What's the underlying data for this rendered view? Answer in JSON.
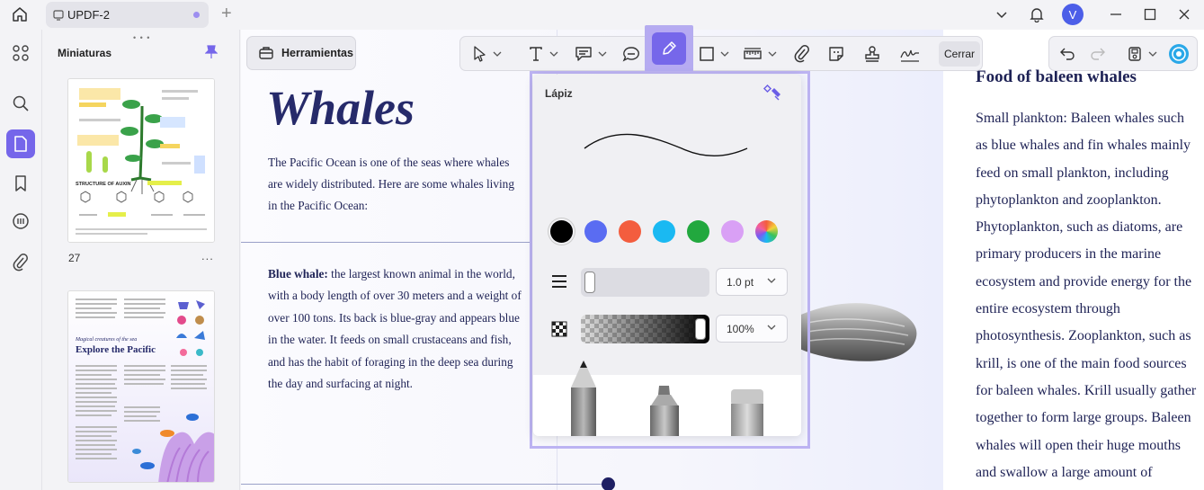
{
  "window": {
    "tab_title": "UPDF-2",
    "avatar_initial": "V"
  },
  "thumbnails": {
    "title": "Miniaturas",
    "page1_number": "27",
    "page1_more": "...",
    "page2_heading": "Explore the Pacific",
    "page2_subheading": "Magical creatures of the sea",
    "page1_heading": "STRUCTURE OF AUXIN"
  },
  "toolbar": {
    "tools_label": "Herramientas",
    "close_label": "Cerrar"
  },
  "popup": {
    "title": "Lápiz",
    "thickness_value": "1.0 pt",
    "opacity_value": "100%",
    "colors": [
      "#000000",
      "#5a6cf2",
      "#f35d3e",
      "#1ab9f2",
      "#22a83e",
      "#d9a0f5"
    ]
  },
  "document": {
    "title": "Whales",
    "intro": "The Pacific Ocean is one of the seas where whales are widely distributed. Here are some whales living in the Pacific Ocean:",
    "blue_label": "Blue whale:",
    "blue_text": " the largest known animal in the world, with a body length of over 30 meters and a weight of over 100 tons. Its back is blue-gray and appears blue in the water. It feeds on small crustaceans and fish, and has the habit of foraging in the deep sea during the day and surfacing at night.",
    "food_title": "Food of baleen whales",
    "food_text": "Small plankton: Baleen whales such\nas blue whales and fin whales mainly\nfeed on small plankton, including\nphytoplankton and zooplankton.\nPhytoplankton, such as diatoms, are\nprimary producers in the marine\necosystem and provide energy for the\nentire ecosystem through\nphotosynthesis. Zooplankton, such as\nkrill, is one of the main food sources\nfor baleen whales. Krill usually gather\ntogether to form large groups. Baleen\nwhales will open their huge mouths\nand swallow a large amount of"
  }
}
